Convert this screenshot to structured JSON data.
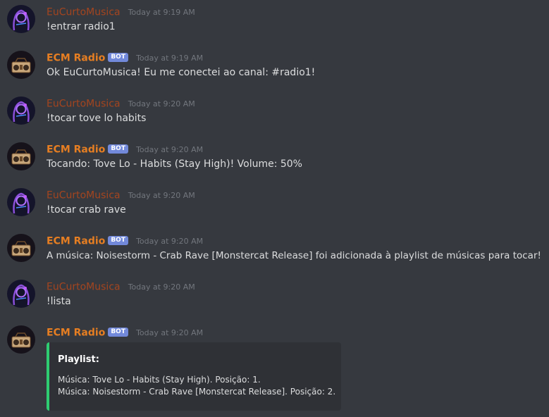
{
  "colors": {
    "background": "#36393f",
    "user_name": "#a4451f",
    "bot_name": "#e67e22",
    "bot_tag": "#7289da",
    "timestamp": "#72767d",
    "text": "#dcddde",
    "embed_background": "#2f3136",
    "embed_accent": "#2ecc71"
  },
  "icons": {
    "user_avatar": "neon-anime-character-avatar",
    "bot_avatar": "retro-boombox-radio-avatar"
  },
  "messages": [
    {
      "author": "EuCurtoMusica",
      "is_bot": false,
      "timestamp": "Today at 9:19 AM",
      "text": "!entrar radio1"
    },
    {
      "author": "ECM Radio",
      "is_bot": true,
      "bot_tag": "BOT",
      "timestamp": "Today at 9:19 AM",
      "text": "Ok EuCurtoMusica! Eu me conectei ao canal: #radio1!"
    },
    {
      "author": "EuCurtoMusica",
      "is_bot": false,
      "timestamp": "Today at 9:20 AM",
      "text": "!tocar tove lo habits"
    },
    {
      "author": "ECM Radio",
      "is_bot": true,
      "bot_tag": "BOT",
      "timestamp": "Today at 9:20 AM",
      "text": "Tocando: Tove Lo - Habits (Stay High)! Volume: 50%"
    },
    {
      "author": "EuCurtoMusica",
      "is_bot": false,
      "timestamp": "Today at 9:20 AM",
      "text": "!tocar crab rave"
    },
    {
      "author": "ECM Radio",
      "is_bot": true,
      "bot_tag": "BOT",
      "timestamp": "Today at 9:20 AM",
      "text": "A música: Noisestorm - Crab Rave [Monstercat Release] foi adicionada à playlist de músicas para tocar!"
    },
    {
      "author": "EuCurtoMusica",
      "is_bot": false,
      "timestamp": "Today at 9:20 AM",
      "text": "!lista"
    },
    {
      "author": "ECM Radio",
      "is_bot": true,
      "bot_tag": "BOT",
      "timestamp": "Today at 9:20 AM",
      "embed": {
        "title": "Playlist:",
        "lines": [
          "Música: Tove Lo - Habits (Stay High). Posição: 1.",
          "Música: Noisestorm - Crab Rave [Monstercat Release]. Posição: 2."
        ]
      }
    }
  ]
}
